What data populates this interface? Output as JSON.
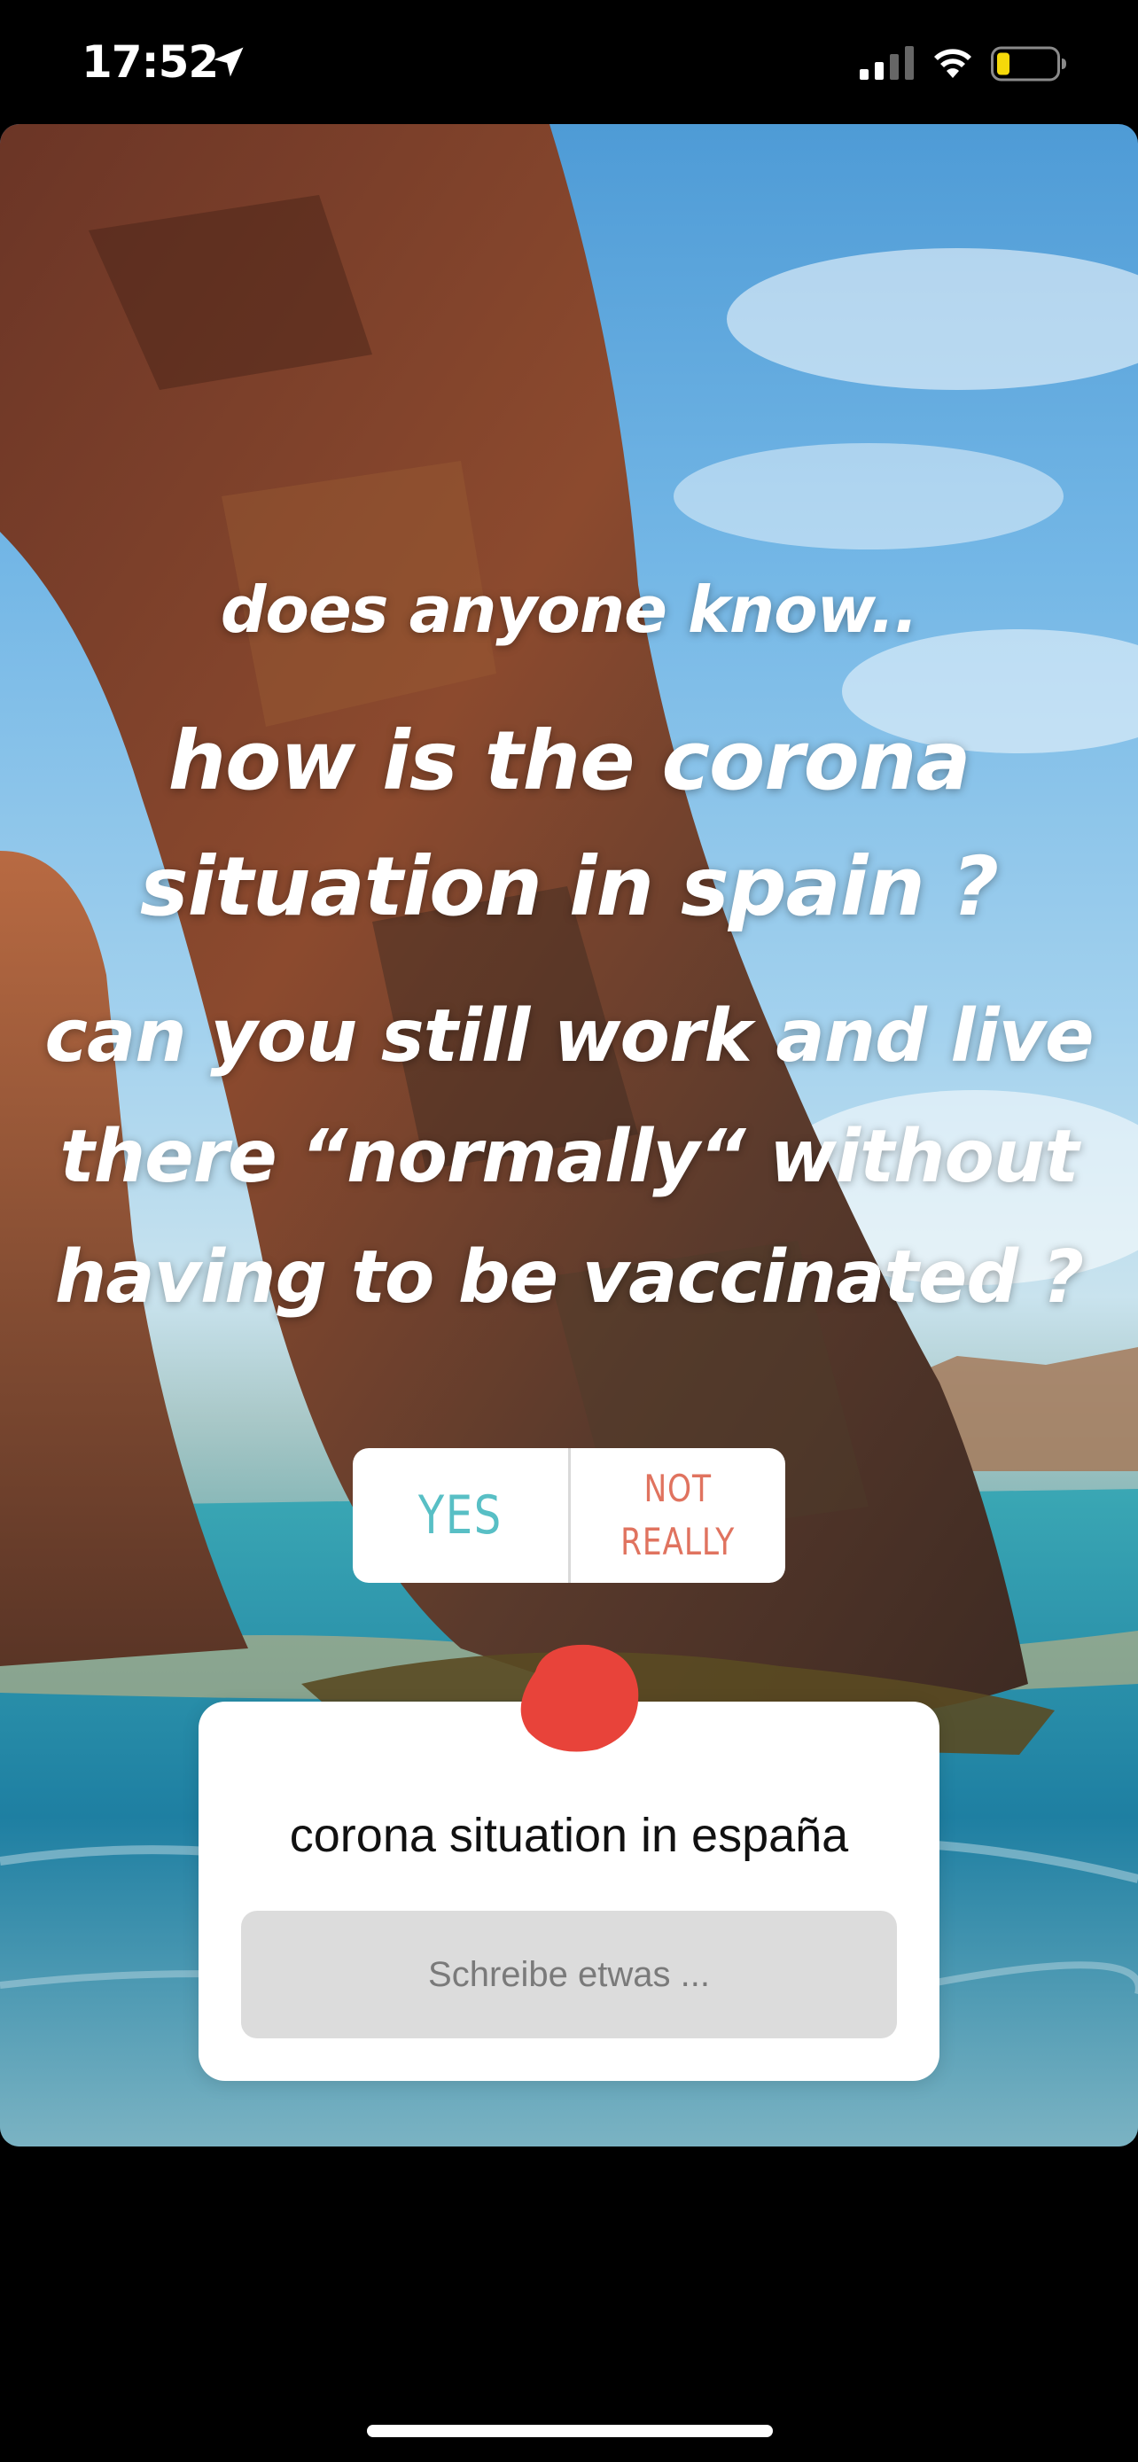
{
  "status_bar": {
    "time": "17:52",
    "location_icon": "location-arrow-icon",
    "signal_icon": "cellular-signal-icon",
    "wifi_icon": "wifi-icon",
    "battery_icon": "battery-low-icon",
    "battery_color": "#f5d90a"
  },
  "story": {
    "line1": "does anyone know..",
    "line2": "how is the corona situation in spain ?",
    "line3": "can you still work and live there “normally“ without having to be vaccinated ?"
  },
  "poll": {
    "option_yes": "YES",
    "option_no_line1": "NOT",
    "option_no_line2": "REALLY",
    "yes_color": "#58bfc5",
    "no_color": "#e0735f"
  },
  "question_sticker": {
    "title": "corona situation in españa",
    "placeholder": "Schreibe etwas ..."
  },
  "colors": {
    "redaction": "#e8433a",
    "background": "#000000"
  }
}
